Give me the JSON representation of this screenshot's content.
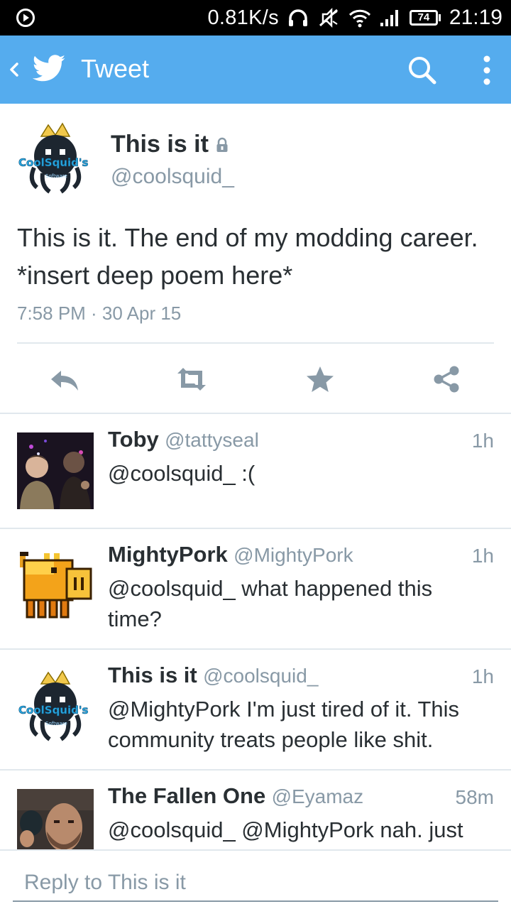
{
  "status_bar": {
    "speed": "0.81K/s",
    "battery": "74",
    "time": "21:19"
  },
  "app_bar": {
    "title": "Tweet"
  },
  "main_tweet": {
    "name": "This is it",
    "handle": "@coolsquid_",
    "text": "This is it. The end of my modding career. *insert deep poem here*",
    "meta": "7:58 PM · 30 Apr 15"
  },
  "replies": [
    {
      "name": "Toby",
      "handle": "@tattyseal",
      "time": "1h",
      "text": "@coolsquid_ :("
    },
    {
      "name": "MightyPork",
      "handle": "@MightyPork",
      "time": "1h",
      "text": "@coolsquid_ what happened this time?"
    },
    {
      "name": "This is it",
      "handle": "@coolsquid_",
      "time": "1h",
      "text": "@MightyPork I'm just tired of it. This community treats people like shit."
    },
    {
      "name": "The Fallen One",
      "handle": "@Eyamaz",
      "time": "58m",
      "text": "@coolsquid_ @MightyPork nah. just"
    }
  ],
  "reply_bar": {
    "placeholder": "Reply to This is it"
  },
  "avatar_logo": {
    "brand": "CoolSquid's",
    "sub": "Software"
  },
  "colors": {
    "brand": "#55acee",
    "text": "#292f33",
    "muted": "#8899a6",
    "divider": "#e1e8ed"
  },
  "icons": [
    "play-icon",
    "headphones-icon",
    "mute-icon",
    "wifi-icon",
    "signal-icon",
    "battery-icon",
    "back-chevron-icon",
    "twitter-bird-icon",
    "search-icon",
    "overflow-menu-icon",
    "lock-icon",
    "reply-icon",
    "retweet-icon",
    "favorite-star-icon",
    "share-icon"
  ]
}
